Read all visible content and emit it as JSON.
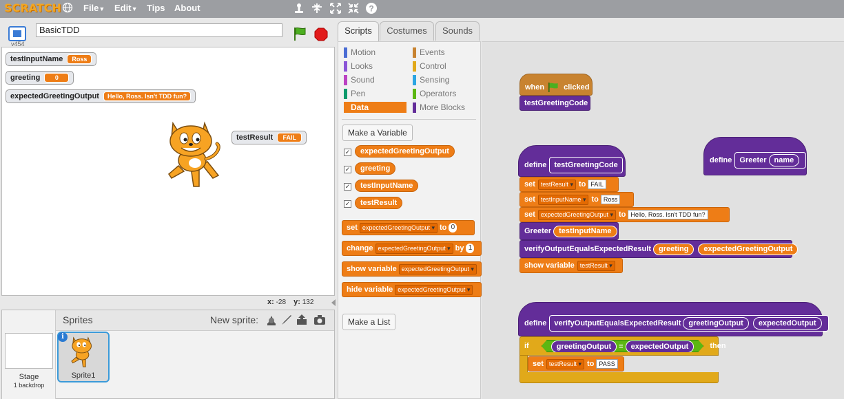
{
  "menu": {
    "logo": "SCRATCH",
    "items": [
      {
        "label": "File",
        "has_caret": true
      },
      {
        "label": "Edit",
        "has_caret": true
      },
      {
        "label": "Tips",
        "has_caret": false
      },
      {
        "label": "About",
        "has_caret": false
      }
    ],
    "tools": [
      "duplicate-icon",
      "cut-icon",
      "grow-icon",
      "shrink-icon",
      "help-icon"
    ]
  },
  "stage_header": {
    "version": "v454",
    "project_title": "BasicTDD"
  },
  "monitors": [
    {
      "name": "testInputName",
      "value": "Ross"
    },
    {
      "name": "greeting",
      "value": "0"
    },
    {
      "name": "expectedGreetingOutput",
      "value": "Hello, Ross. Isn't TDD fun?"
    },
    {
      "name": "testResult",
      "value": "FAIL"
    }
  ],
  "coords": {
    "x_label": "x:",
    "x": "-28",
    "y_label": "y:",
    "y": "132"
  },
  "sprites_panel": {
    "title": "Sprites",
    "new_sprite_label": "New sprite:",
    "stage_label": "Stage",
    "backdrop_count": "1 backdrop",
    "sprites": [
      {
        "name": "Sprite1"
      }
    ]
  },
  "tabs": [
    {
      "label": "Scripts",
      "active": true
    },
    {
      "label": "Costumes",
      "active": false
    },
    {
      "label": "Sounds",
      "active": false
    }
  ],
  "categories": {
    "left": [
      {
        "label": "Motion",
        "color": "#4a6cd4"
      },
      {
        "label": "Looks",
        "color": "#8a55d7"
      },
      {
        "label": "Sound",
        "color": "#bb42c3"
      },
      {
        "label": "Pen",
        "color": "#0e9a6c"
      },
      {
        "label": "Data",
        "color": "#ee7d16",
        "selected": true
      }
    ],
    "right": [
      {
        "label": "Events",
        "color": "#c88330"
      },
      {
        "label": "Control",
        "color": "#e1a91a"
      },
      {
        "label": "Sensing",
        "color": "#2ca5e2"
      },
      {
        "label": "Operators",
        "color": "#5cb712"
      },
      {
        "label": "More Blocks",
        "color": "#632d99"
      }
    ]
  },
  "palette": {
    "make_variable": "Make a Variable",
    "variables": [
      "expectedGreetingOutput",
      "greeting",
      "testInputName",
      "testResult"
    ],
    "blocks": {
      "set_kw": "set",
      "set_var": "expectedGreetingOutput",
      "set_to": "to",
      "set_val": "0",
      "change_kw": "change",
      "change_var": "expectedGreetingOutput",
      "change_by": "by",
      "change_val": "1",
      "show_kw": "show variable",
      "show_var": "expectedGreetingOutput",
      "hide_kw": "hide variable",
      "hide_var": "expectedGreetingOutput"
    },
    "make_list": "Make a List"
  },
  "scripts": {
    "when": "when",
    "clicked": "clicked",
    "call_test": "testGreetingCode",
    "define_kw": "define",
    "def1_name": "testGreetingCode",
    "set_kw": "set",
    "to_kw": "to",
    "s1_var": "testResult",
    "s1_val": "FAIL",
    "s2_var": "testInputName",
    "s2_val": "Ross",
    "s3_var": "expectedGreetingOutput",
    "s3_val": "Hello, Ross. Isn't TDD fun?",
    "greeter_call": "Greeter",
    "greeter_arg": "testInputName",
    "verify_call": "verifyOutputEqualsExpectedResult",
    "verify_arg1": "greeting",
    "verify_arg2": "expectedGreetingOutput",
    "show_kw": "show variable",
    "show_var": "testResult",
    "def2_name": "Greeter",
    "def2_param": "name",
    "def3_name": "verifyOutputEqualsExpectedResult",
    "def3_p1": "greetingOutput",
    "def3_p2": "expectedOutput",
    "if_kw": "if",
    "then_kw": "then",
    "eq": "=",
    "cmp_left": "greetingOutput",
    "cmp_right": "expectedOutput",
    "s4_var": "testResult",
    "s4_val": "PASS"
  }
}
